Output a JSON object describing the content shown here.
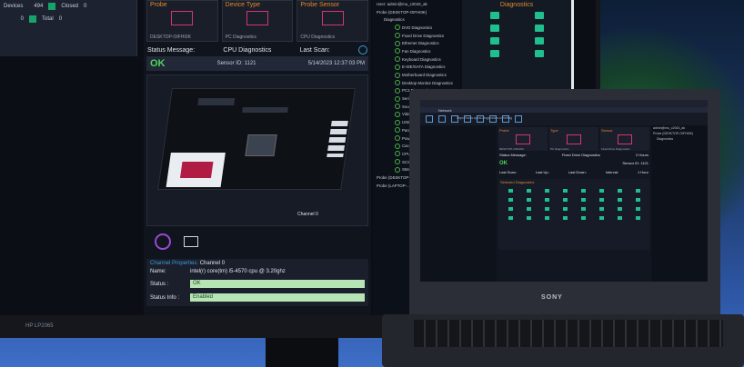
{
  "mini_window": {
    "rows": [
      {
        "label": "Devices",
        "value": "494",
        "closed_label": "Closed",
        "closed_value": "0"
      },
      {
        "label": "",
        "value": "0",
        "closed_label": "Total",
        "closed_value": "0"
      }
    ]
  },
  "cards": [
    {
      "title": "Probe",
      "subtitle": "DESKTOP-OIFHI0K"
    },
    {
      "title": "Device Type",
      "subtitle": "PC Diagnostics"
    },
    {
      "title": "Probe Sensor",
      "subtitle": "CPU Diagnostics"
    }
  ],
  "status": {
    "message_label": "Status Message:",
    "message_value": "CPU Diagnostics",
    "last_scan_label": "Last Scan:",
    "ok_text": "OK",
    "sensor_id": "Sensor ID: 1121",
    "scan_time": "5/14/2023 12:37:03 PM"
  },
  "board": {
    "channel_label": "Channel 0"
  },
  "properties": {
    "header": "Channel Properties:",
    "header_value": "Channel 0",
    "name_label": "Name:",
    "name_value": "intel(r) core(tm) i5-4570 cpu @ 3.20ghz",
    "status_label": "Status :",
    "status_value": "OK",
    "info_label": "Status Info :",
    "info_value": "Enabled"
  },
  "tree": {
    "user": "User: admin@mu_c2043_ak",
    "probe_root": "Probe (DESKTOP-OIFHI0K)",
    "group": "Diagnostics",
    "items": [
      "DVD Diagnostics",
      "Fixed Drive Diagnostics",
      "Ethernet Diagnostics",
      "Fan Diagnostics",
      "Keyboard Diagnostics",
      "E-IDE/SATA Diagnostics",
      "Motherboard Diagnostics",
      "Desktop Monitor Diagnostics",
      "PC2 Diagnostics",
      "Serial Diagnostics",
      "Sound Diagnostics",
      "Video Diagnostics",
      "USB Diagnostics",
      "Parallel Diagnostics",
      "Power Diagnostics",
      "Cache Diagnostics",
      "CPU Diagnostics",
      "SCSI Diagnostics",
      "SMART Diagnostics"
    ],
    "probe_b": "Probe (DESKTOP-...)",
    "probe_c": "Probe (LAPTOP-...)"
  },
  "diagnostics_panel": {
    "title": "Diagnostics"
  },
  "monitor": {
    "brand": "HP LP2065"
  },
  "laptop": {
    "brand": "SONY",
    "url": "https://www.spiral-diagnostics.com/diag",
    "tab": "Network",
    "cards": [
      {
        "title": "Probe",
        "subtitle": "DESKTOP-OIFHI0K"
      },
      {
        "title": "Type",
        "subtitle": "PC Diagnostics"
      },
      {
        "title": "Sensor",
        "subtitle": "Fixed Drive Diagnostics"
      }
    ],
    "status_label": "Status Message:",
    "status_value": "Fixed Drive Diagnostics",
    "ok_text": "OK",
    "hours": "2 Hours",
    "sensor_id": "Sensor ID: 1121",
    "last_scan_label": "Last Scan:",
    "last_up_label": "Last Up:",
    "last_down_label": "Last Down:",
    "interval_label": "Interval:",
    "interval_value": "1 Hour",
    "diag_title": "Selected Diagnostics",
    "right_user": "admin@mu_c2043_ak",
    "right_probe": "Probe (DESKTOP-OIFHI0K)",
    "right_group": "Diagnostics"
  }
}
